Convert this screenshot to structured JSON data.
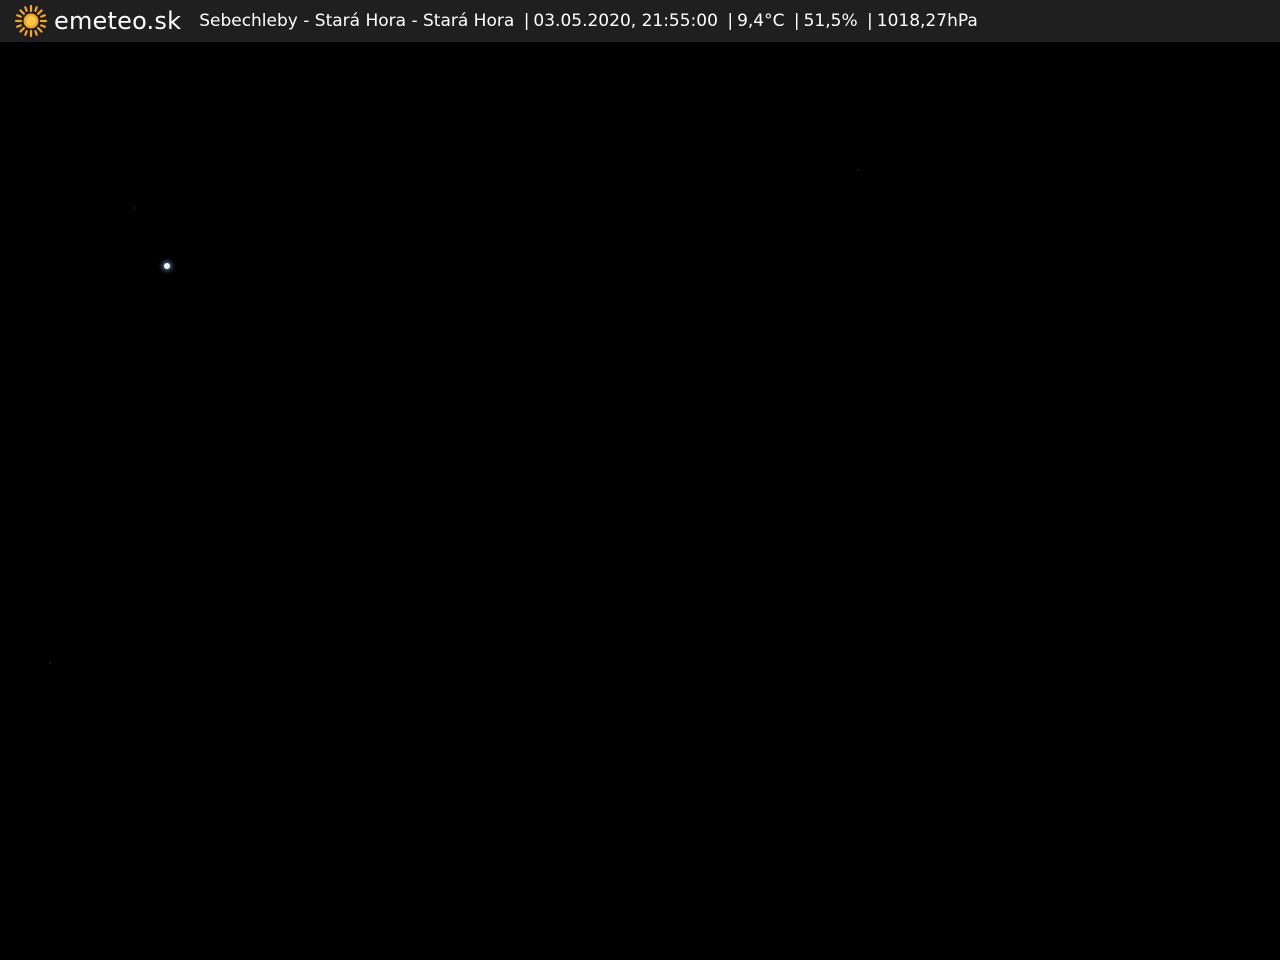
{
  "brand": {
    "name": "emeteo.sk",
    "icon": "sun-icon",
    "accent_color": "#f5a623"
  },
  "caption": {
    "location": "Sebechleby - Stará Hora - Stará Hora",
    "datetime": "03.05.2020, 21:55:00",
    "temperature": "9,4°C",
    "humidity": "51,5%",
    "pressure": "1018,27hPa",
    "separator": "|"
  },
  "scene": {
    "background_color": "#000000"
  }
}
